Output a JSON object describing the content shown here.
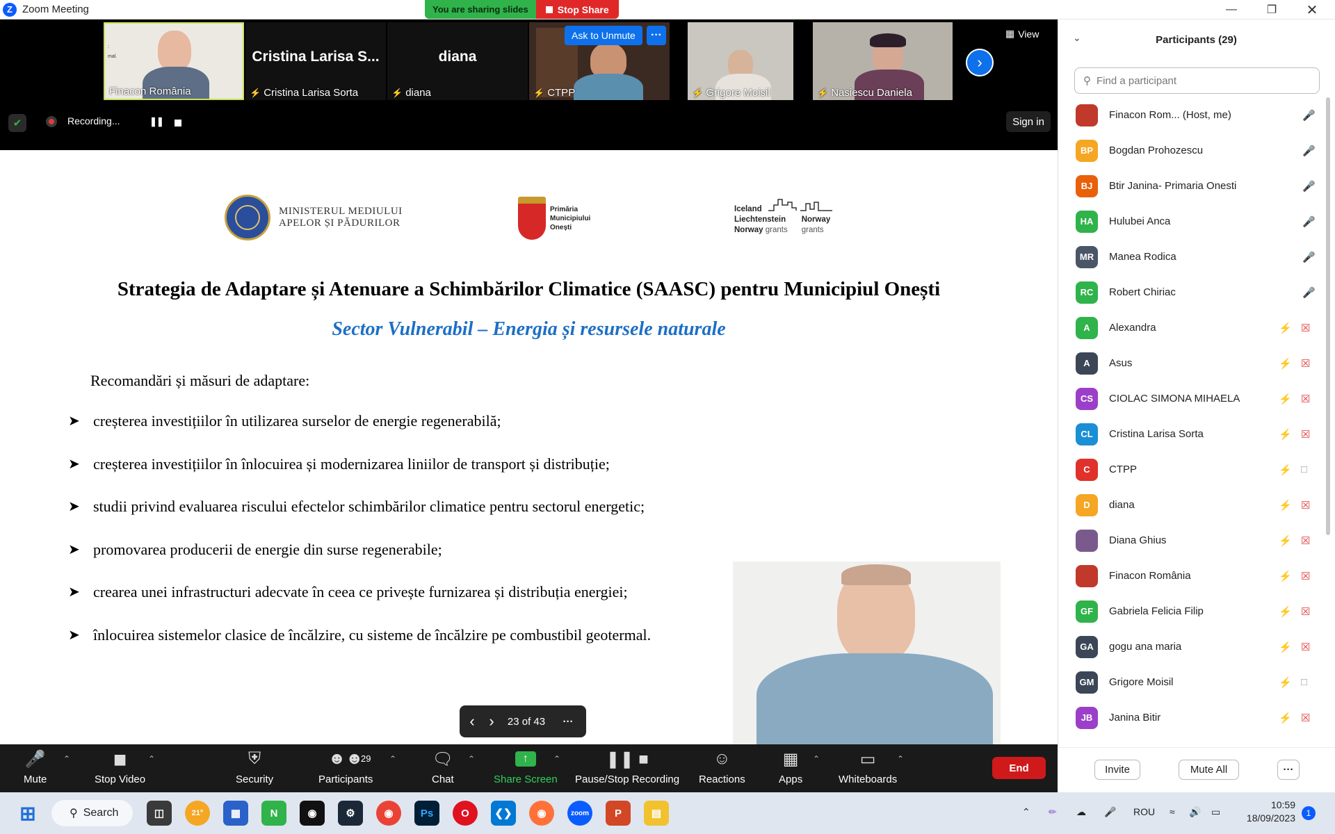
{
  "window": {
    "title": "Zoom Meeting",
    "minimize_icon": "minimize-icon",
    "restore_icon": "restore-icon",
    "close_icon": "close-icon"
  },
  "share_banner": {
    "sharing_text": "You are sharing slides",
    "stop_label": "Stop Share"
  },
  "video_strip": {
    "tiles": [
      {
        "name": "Finacon România",
        "muted": false
      },
      {
        "name": "Cristina Larisa Sorta",
        "display_title": "Cristina  Larisa  S...",
        "muted": true
      },
      {
        "name": "diana",
        "display_title": "diana",
        "muted": true
      },
      {
        "name": "CTPP",
        "muted": true
      },
      {
        "name": "Grigore Moisil",
        "muted": true
      },
      {
        "name": "Nasiescu Daniela",
        "muted": true
      }
    ],
    "ask_to_unmute_label": "Ask to Unmute",
    "more_label": "···",
    "view_label": "View"
  },
  "recording": {
    "status_text": "Recording...",
    "sign_in_label": "Sign in"
  },
  "slide": {
    "logos": {
      "ministry": "MINISTERUL MEDIULUI\nAPELOR ȘI PĂDURILOR",
      "ministry_l1": "MINISTERUL MEDIULUI",
      "ministry_l2": "APELOR ȘI PĂDURILOR",
      "primaria_l1": "Primăria",
      "primaria_l2": "Municipiului",
      "primaria_l3": "Onești",
      "eea_l1": "Iceland",
      "eea_l2": "Liechtenstein",
      "eea_l3a": "Norway",
      "eea_l3b": "grants",
      "eea_r1": "Norway",
      "eea_r2": "grants"
    },
    "title": "Strategia de Adaptare și Atenuare a Schimbărilor Climatice (SAASC) pentru Municipiul Onești",
    "subtitle": "Sector Vulnerabil – Energia și resursele naturale",
    "heading": "Recomandări și măsuri de adaptare:",
    "bullets": [
      "creșterea investițiilor în utilizarea surselor de energie regenerabilă;",
      "creșterea investițiilor în înlocuirea și modernizarea liniilor de transport și distribuție;",
      "studii privind evaluarea riscului efectelor schimbărilor climatice pentru sectorul energetic;",
      "promovarea producerii de energie din surse regenerabile;",
      "crearea unei infrastructuri adecvate în ceea ce privește furnizarea și distribuția energiei;",
      "înlocuirea sistemelor clasice de încălzire, cu sisteme de încălzire pe combustibil geotermal."
    ],
    "page_indicator": "23 of 43"
  },
  "toolbar": {
    "mute": "Mute",
    "stop_video": "Stop Video",
    "security": "Security",
    "participants": "Participants",
    "participants_count": "29",
    "chat": "Chat",
    "share_screen": "Share Screen",
    "pause_recording": "Pause/Stop Recording",
    "reactions": "Reactions",
    "apps": "Apps",
    "whiteboards": "Whiteboards",
    "end": "End"
  },
  "participants_panel": {
    "title": "Participants (29)",
    "search_placeholder": "Find a participant",
    "participants": [
      {
        "initials": "",
        "name": "Finacon Rom...  (Host, me)",
        "color": "#c0392b",
        "mic_muted": false,
        "video_off": false
      },
      {
        "initials": "BP",
        "name": "Bogdan Prohozescu",
        "color": "#f5a623",
        "mic_muted": false,
        "video_off": false
      },
      {
        "initials": "BJ",
        "name": "Btir Janina- Primaria  Onesti",
        "color": "#e8600a",
        "mic_muted": false,
        "video_off": false
      },
      {
        "initials": "HA",
        "name": "Hulubei Anca",
        "color": "#2fb34a",
        "mic_muted": false,
        "video_off": false
      },
      {
        "initials": "MR",
        "name": "Manea Rodica",
        "color": "#4a5668",
        "mic_muted": false,
        "video_off": false
      },
      {
        "initials": "RC",
        "name": "Robert Chiriac",
        "color": "#2fb34a",
        "mic_muted": false,
        "video_off": false
      },
      {
        "initials": "A",
        "name": "Alexandra",
        "color": "#2fb34a",
        "mic_muted": true,
        "video_off": true
      },
      {
        "initials": "A",
        "name": "Asus",
        "color": "#3b4656",
        "mic_muted": true,
        "video_off": true
      },
      {
        "initials": "CS",
        "name": "CIOLAC SIMONA MIHAELA",
        "color": "#9b3fc9",
        "mic_muted": true,
        "video_off": true
      },
      {
        "initials": "CL",
        "name": "Cristina Larisa Sorta",
        "color": "#1a8fd6",
        "mic_muted": true,
        "video_off": true
      },
      {
        "initials": "C",
        "name": "CTPP",
        "color": "#e0312b",
        "mic_muted": true,
        "video_off": false
      },
      {
        "initials": "D",
        "name": "diana",
        "color": "#f5a623",
        "mic_muted": true,
        "video_off": true
      },
      {
        "initials": "",
        "name": "Diana Ghius",
        "color": "#7a5a8c",
        "mic_muted": true,
        "video_off": true
      },
      {
        "initials": "",
        "name": "Finacon România",
        "color": "#c0392b",
        "mic_muted": true,
        "video_off": true
      },
      {
        "initials": "GF",
        "name": "Gabriela Felicia Filip",
        "color": "#2fb34a",
        "mic_muted": true,
        "video_off": true
      },
      {
        "initials": "GA",
        "name": "gogu ana maria",
        "color": "#3b4656",
        "mic_muted": true,
        "video_off": true
      },
      {
        "initials": "GM",
        "name": "Grigore Moisil",
        "color": "#3b4656",
        "mic_muted": true,
        "video_off": false
      },
      {
        "initials": "JB",
        "name": "Janina Bitir",
        "color": "#9b3fc9",
        "mic_muted": true,
        "video_off": true
      }
    ],
    "invite_label": "Invite",
    "mute_all_label": "Mute All",
    "more_label": "···"
  },
  "taskbar": {
    "search_label": "Search",
    "weather": "21°",
    "language": "ROU",
    "time": "10:59",
    "date": "18/09/2023",
    "notifications": "1"
  }
}
